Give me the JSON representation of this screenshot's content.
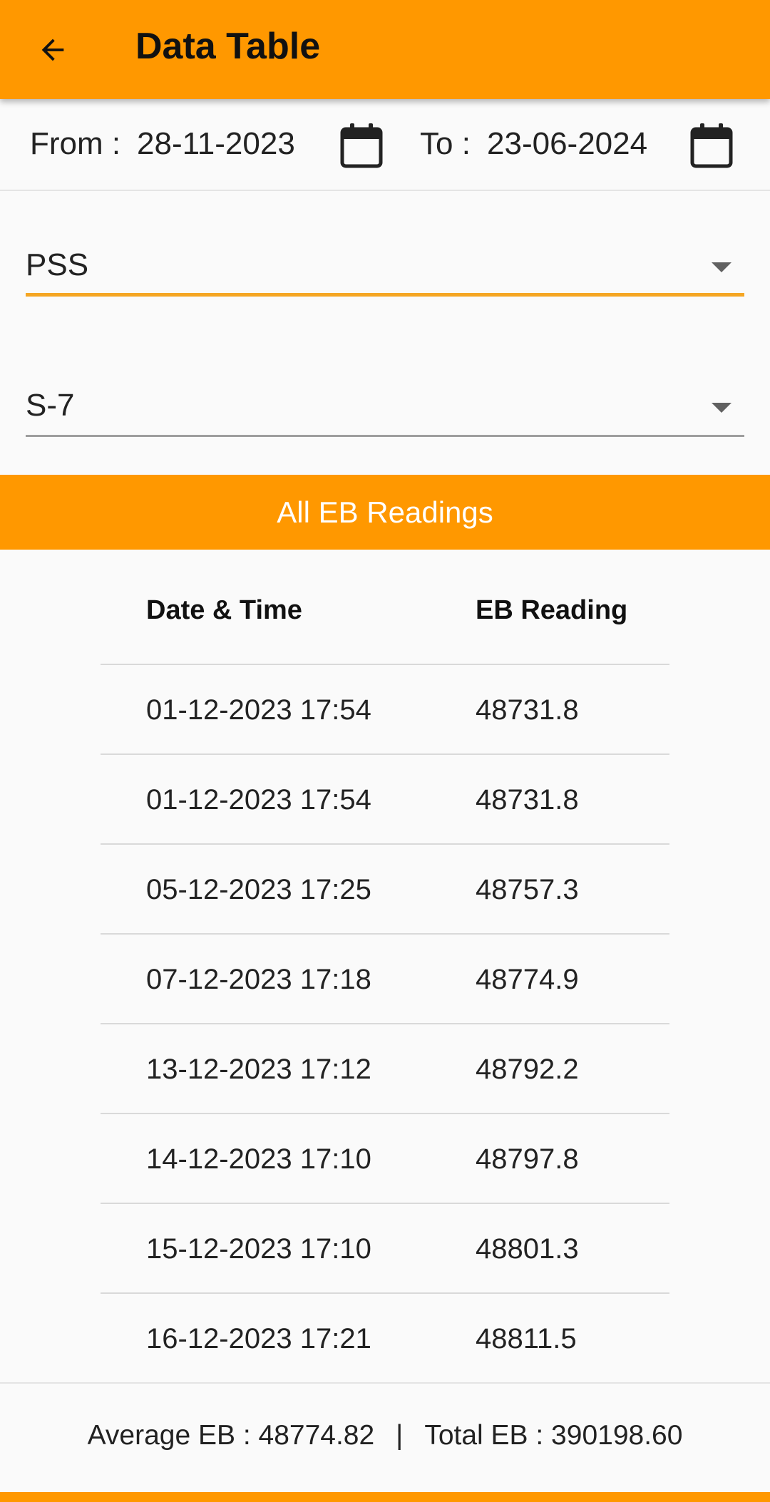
{
  "appbar": {
    "title": "Data Table",
    "back_icon": "arrow-left-icon",
    "color": "#ff9800"
  },
  "dates": {
    "from_label": "From :",
    "from_value": "28-11-2023",
    "to_label": "To :",
    "to_value": "23-06-2024",
    "calendar_icon": "calendar-icon"
  },
  "dropdowns": {
    "first": {
      "value": "PSS",
      "focused": true,
      "accent": "#f5a623"
    },
    "second": {
      "value": "S-7",
      "focused": false
    }
  },
  "section": {
    "title": "All EB Readings"
  },
  "table": {
    "headers": [
      "Date & Time",
      "EB Reading"
    ],
    "rows": [
      [
        "01-12-2023 17:54",
        "48731.8"
      ],
      [
        "01-12-2023 17:54",
        "48731.8"
      ],
      [
        "05-12-2023 17:25",
        "48757.3"
      ],
      [
        "07-12-2023 17:18",
        "48774.9"
      ],
      [
        "13-12-2023 17:12",
        "48792.2"
      ],
      [
        "14-12-2023 17:10",
        "48797.8"
      ],
      [
        "15-12-2023 17:10",
        "48801.3"
      ],
      [
        "16-12-2023 17:21",
        "48811.5"
      ]
    ]
  },
  "summary": {
    "average_label": "Average EB : 48774.82",
    "separator": "|",
    "total_label": "Total EB : 390198.60"
  }
}
